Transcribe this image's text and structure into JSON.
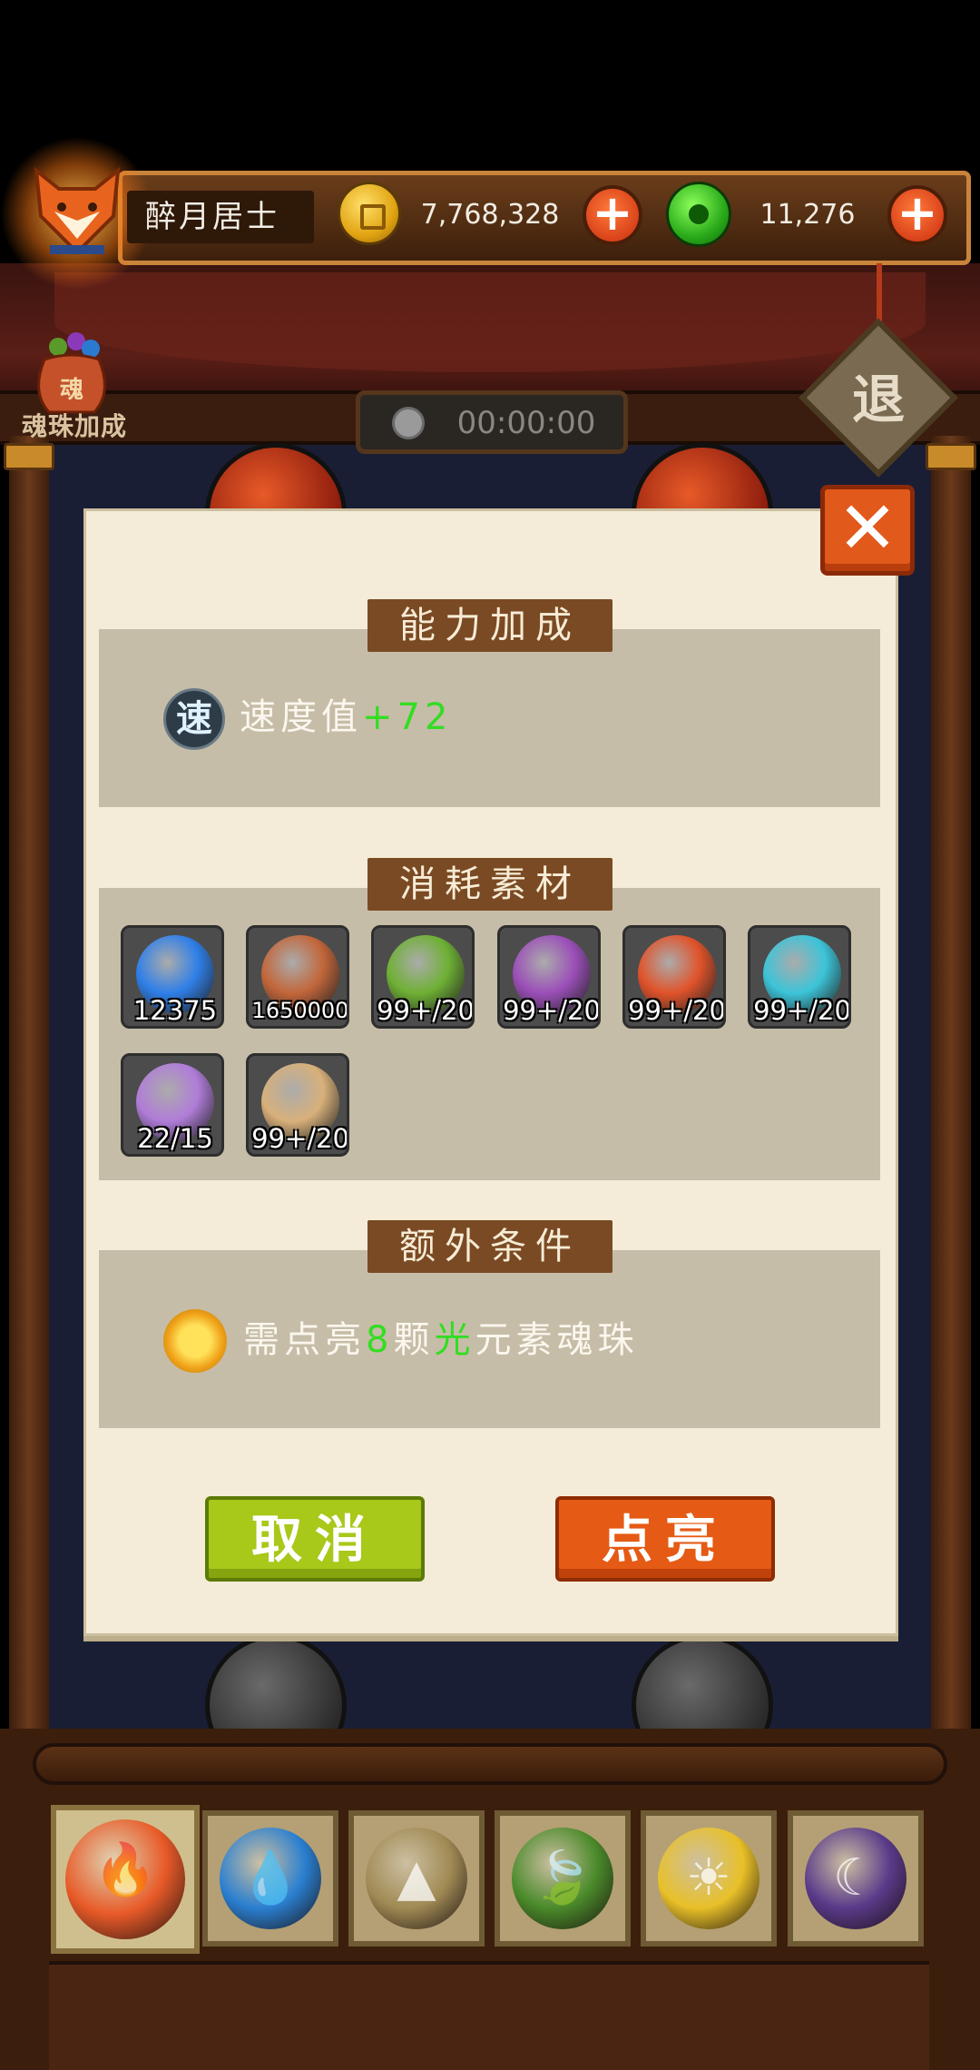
{
  "header": {
    "player_name": "醉月居士",
    "gold_amount": "7,768,328",
    "jade_amount": "11,276",
    "add_gold_icon": "plus-icon",
    "add_jade_icon": "plus-icon"
  },
  "toolbar": {
    "bonus_label": "魂珠加成",
    "timer": "00:00:00",
    "exit_label": "退"
  },
  "dialog": {
    "close_icon": "close-icon",
    "ability_title": "能力加成",
    "speed_badge": "速",
    "speed_label": "速度值",
    "speed_bonus": "+72",
    "materials_title": "消耗素材",
    "materials": [
      {
        "name": "blue-flame",
        "count": "12375",
        "color": "#2f7fe8"
      },
      {
        "name": "coin-bag",
        "count": "1650000",
        "color": "#c2663a"
      },
      {
        "name": "clover-orb",
        "count": "99+/20",
        "color": "#6eb034"
      },
      {
        "name": "feather-orb",
        "count": "99+/20",
        "color": "#9b4fb8"
      },
      {
        "name": "heart-orb",
        "count": "99+/20",
        "color": "#e0532a"
      },
      {
        "name": "crystal-orb",
        "count": "99+/20",
        "color": "#3cc4d8"
      },
      {
        "name": "book-orb",
        "count": "22/15",
        "color": "#b07cd8"
      },
      {
        "name": "gem-badge-orb",
        "count": "99+/20",
        "color": "#d8b07a"
      }
    ],
    "extra_title": "额外条件",
    "cond_prefix": "需点亮",
    "cond_count": "8",
    "cond_mid": "颗",
    "cond_element": "光",
    "cond_suffix": "元素魂珠",
    "cancel_label": "取消",
    "confirm_label": "点亮"
  },
  "element_tabs": [
    {
      "name": "fire",
      "color": "#e85a28",
      "glyph": "🔥",
      "active": true
    },
    {
      "name": "water",
      "color": "#2a7fd0",
      "glyph": "💧",
      "active": false
    },
    {
      "name": "earth",
      "color": "#a08a54",
      "glyph": "▲",
      "active": false
    },
    {
      "name": "wood",
      "color": "#4a8a2a",
      "glyph": "🍃",
      "active": false
    },
    {
      "name": "light",
      "color": "#e8c028",
      "glyph": "☀",
      "active": false
    },
    {
      "name": "dark",
      "color": "#5a3a8a",
      "glyph": "☾",
      "active": false
    }
  ]
}
